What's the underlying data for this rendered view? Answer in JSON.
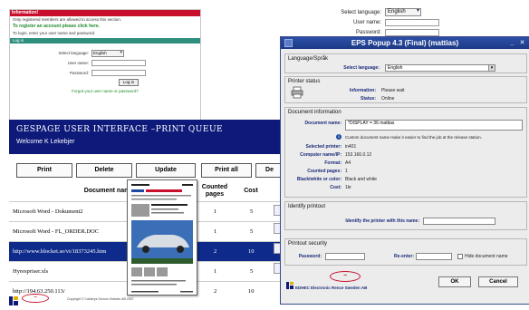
{
  "login_panel": {
    "info_title": "Information!",
    "info_text": "Only registered members are allowed to access this section.",
    "register_link": "To register an account please click here.",
    "login_instructions": "To login, enter your user name and password.",
    "login_bar": "Log in",
    "language_label": "Select language:",
    "language_value": "English",
    "username_label": "User name:",
    "password_label": "Password:",
    "login_button": "Log in",
    "forgot_link": "Forgot your user name or password?"
  },
  "top_right_form": {
    "language_label": "Select language:",
    "language_value": "English",
    "username_label": "User name:",
    "password_label": "Password:"
  },
  "queue": {
    "title": "GESPAGE USER INTERFACE –PRINT QUEUE",
    "welcome": "Welcome K Lekebjer",
    "buttons": {
      "print": "Print",
      "delete": "Delete",
      "update": "Update",
      "print_all": "Print all",
      "delete_all": "De"
    },
    "headers": {
      "document": "Document name",
      "pages": "Counted pages",
      "cost": "Cost"
    },
    "rows": [
      {
        "document": "Microsoft Word - Dokument2",
        "pages": "1",
        "cost": "5"
      },
      {
        "document": "Microsoft Word - FL_ORDER.DOC",
        "pages": "1",
        "cost": "5"
      },
      {
        "document": "http://www.blocket.se/vi/18373245.htm",
        "pages": "2",
        "cost": "10"
      },
      {
        "document": "Hyrespriser.xls",
        "pages": "1",
        "cost": "5"
      },
      {
        "document": "http://194.63.250.113/",
        "pages": "2",
        "cost": "10"
      }
    ]
  },
  "footer": {
    "copyright": "Copyright © Calderys Genom Sweden AB 2007"
  },
  "popup": {
    "title": "EPS Popup 4.3 (Final) (mattias)",
    "language_group": "Language/Språk",
    "select_language_label": "Select language:",
    "select_language_value": "English",
    "printer_status_group": "Printer status",
    "information_label": "Information:",
    "information_value": "Please wait",
    "status_label": "Status:",
    "status_value": "Online",
    "doc_info_group": "Document information",
    "document_name_label": "Document name:",
    "document_name_value": "*DISPLAY = 36 mattias",
    "custom_note": "Custom document name make it easier to find the job at the release station.",
    "selected_printer_label": "Selected printer:",
    "selected_printer_value": "in401",
    "computer_name_label": "Computer name/IP:",
    "computer_name_value": "153.166.0.12",
    "format_label": "Format:",
    "format_value": "A4",
    "counted_pages_label": "Counted pages:",
    "counted_pages_value": "1",
    "bw_color_label": "Black/white or color:",
    "bw_color_value": "Black and white",
    "cost_label": "Cost:",
    "cost_value": "1kr",
    "identify_group": "Identify printout",
    "identify_label": "Identify the printer with this name:",
    "security_group": "Printout security",
    "password_label": "Password:",
    "reenter_label": "Re-enter:",
    "hide_doc_label": "Hide document name",
    "brand_text": "EDHEC Electronic Rence Sweden AB",
    "ok_button": "OK",
    "cancel_button": "Cancel"
  },
  "colors": {
    "navy": "#0e1a7a",
    "red": "#c8102e",
    "titlebar": "#2c4fa6"
  }
}
